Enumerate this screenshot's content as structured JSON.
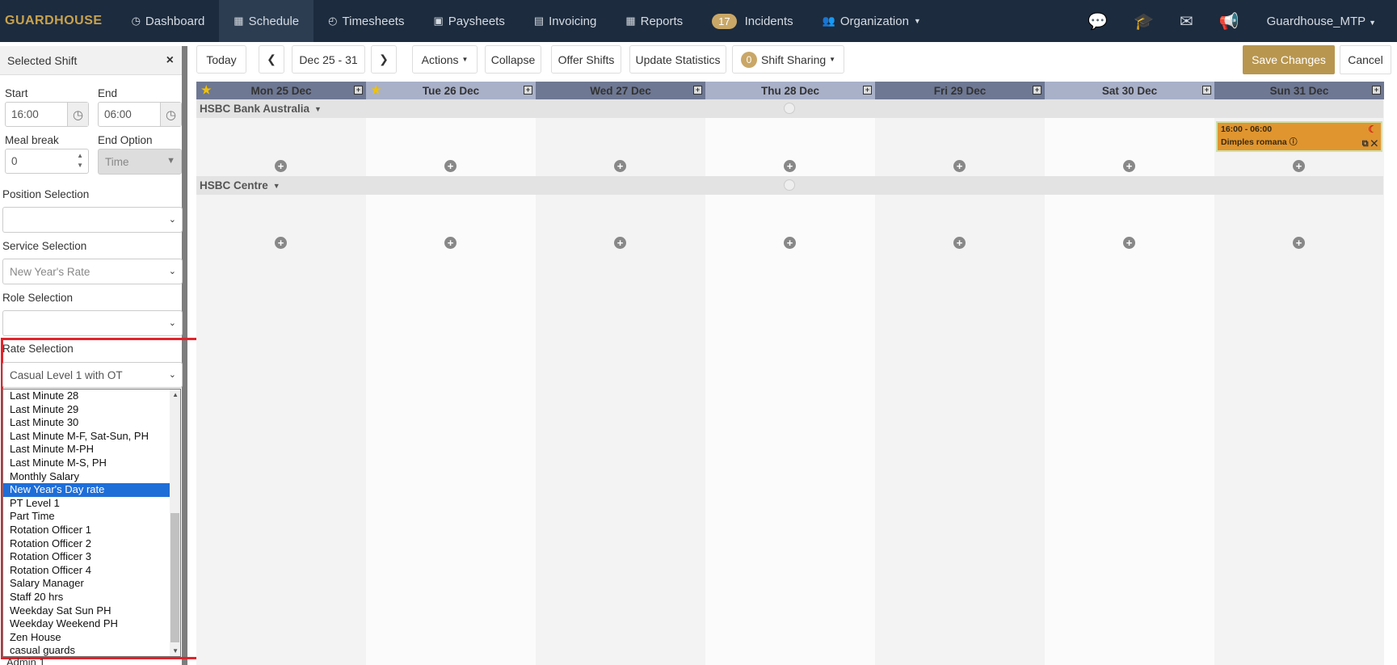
{
  "nav": {
    "brand": "GUARDHOUSE",
    "items": [
      {
        "label": "Dashboard",
        "icon": "dashboard-icon"
      },
      {
        "label": "Schedule",
        "icon": "calendar-icon"
      },
      {
        "label": "Timesheets",
        "icon": "clock-icon"
      },
      {
        "label": "Paysheets",
        "icon": "money-icon"
      },
      {
        "label": "Invoicing",
        "icon": "invoice-icon"
      },
      {
        "label": "Reports",
        "icon": "table-icon"
      },
      {
        "label": "Incidents",
        "badge": "17"
      },
      {
        "label": "Organization",
        "icon": "users-icon"
      }
    ],
    "user": "Guardhouse_MTP"
  },
  "panel": {
    "title": "Selected Shift",
    "start_label": "Start",
    "start_value": "16:00",
    "end_label": "End",
    "end_value": "06:00",
    "meal_label": "Meal break",
    "meal_value": "0",
    "end_option_label": "End Option",
    "end_option_value": "Time",
    "position_label": "Position Selection",
    "position_value": "",
    "service_label": "Service Selection",
    "service_value": "New Year's Rate",
    "role_label": "Role Selection",
    "role_value": "",
    "rate_label": "Rate Selection",
    "rate_value": "Casual Level 1 with OT",
    "rate_options": [
      "Last Minute 28",
      "Last Minute 29",
      "Last Minute 30",
      "Last Minute M-F, Sat-Sun, PH",
      "Last Minute M-PH",
      "Last Minute M-S, PH",
      "Monthly Salary",
      "New Year's Day rate",
      "PT Level 1",
      "Part Time",
      "Rotation Officer 1",
      "Rotation Officer 2",
      "Rotation Officer 3",
      "Rotation Officer 4",
      "Salary Manager",
      "Staff 20 hrs",
      "Weekday Sat Sun PH",
      "Weekday Weekend PH",
      "Zen House",
      "casual guards"
    ],
    "rate_selected_index": 7,
    "below_text": "Admin 1"
  },
  "toolbar": {
    "today": "Today",
    "range": "Dec 25 - 31",
    "actions": "Actions",
    "collapse": "Collapse",
    "offer": "Offer Shifts",
    "update": "Update Statistics",
    "sharing_count": "0",
    "sharing": "Shift Sharing",
    "save": "Save Changes",
    "cancel": "Cancel"
  },
  "days": [
    {
      "label": "Mon 25 Dec",
      "star": true,
      "head_color": "#6e7893"
    },
    {
      "label": "Tue 26 Dec",
      "star": true,
      "head_color": "#a9b1c9"
    },
    {
      "label": "Wed 27 Dec",
      "star": false,
      "head_color": "#6e7893"
    },
    {
      "label": "Thu 28 Dec",
      "star": false,
      "head_color": "#a9b1c9"
    },
    {
      "label": "Fri 29 Dec",
      "star": false,
      "head_color": "#6e7893"
    },
    {
      "label": "Sat 30 Dec",
      "star": false,
      "head_color": "#a9b1c9"
    },
    {
      "label": "Sun 31 Dec",
      "star": false,
      "head_color": "#6e7893"
    }
  ],
  "groups": [
    "HSBC Bank Australia",
    "HSBC Centre"
  ],
  "shift": {
    "time": "16:00 - 06:00",
    "name": "Dimples romana"
  }
}
